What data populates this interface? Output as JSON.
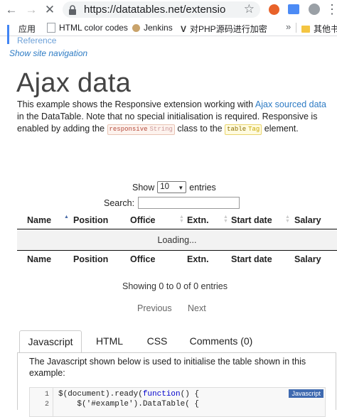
{
  "browser": {
    "url": "https://datatables.net/extensions/r...",
    "bookmarks": [
      "应用",
      "HTML color codes",
      "Jenkins",
      "对PHP源码进行加密",
      "其他书签"
    ],
    "more_label": "»"
  },
  "page": {
    "reference_link": "Reference",
    "show_nav": "Show site navigation",
    "title": "Ajax data",
    "desc_part1": "This example shows the Responsive extension working with ",
    "desc_link": "Ajax sourced data",
    "desc_part2": " in the DataTable. Note that no special initialisation is required. Responsive is enabled by adding the ",
    "tag1_name": "responsive",
    "tag1_kind": "String",
    "desc_part3": " class to the ",
    "tag2_name": "table",
    "tag2_kind": "Tag",
    "desc_part4": " element."
  },
  "datatable": {
    "show_label": "Show",
    "length_value": "10",
    "entries_label": "entries",
    "search_label": "Search:",
    "columns": [
      "Name",
      "Position",
      "Office",
      "Extn.",
      "Start date",
      "Salary"
    ],
    "loading_text": "Loading...",
    "info": "Showing 0 to 0 of 0 entries",
    "prev_label": "Previous",
    "next_label": "Next"
  },
  "code_tabs": {
    "tabs": [
      "Javascript",
      "HTML",
      "CSS",
      "Comments (0)"
    ],
    "active": "Javascript",
    "description": "The Javascript shown below is used to initialise the table shown in this example:",
    "line_numbers": [
      "1",
      "2"
    ],
    "line1_pre": "$(document).ready(",
    "line1_kw": "function",
    "line1_post": "() {",
    "line2": "    $('#example').DataTable( {",
    "badge": "Javascript"
  }
}
